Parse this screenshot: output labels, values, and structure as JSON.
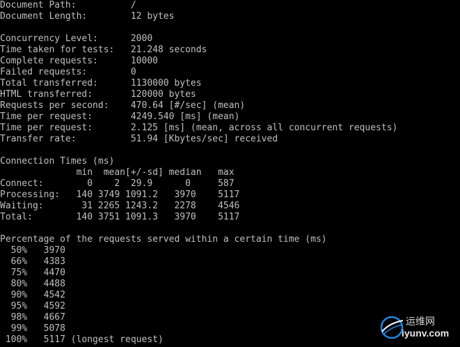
{
  "colors": {
    "background": "#000000",
    "text": "#c0c0c0",
    "watermark_blue": "#1e88e5"
  },
  "console": {
    "lines": [
      "Document Path:          /",
      "Document Length:        12 bytes",
      "",
      "Concurrency Level:      2000",
      "Time taken for tests:   21.248 seconds",
      "Complete requests:      10000",
      "Failed requests:        0",
      "Total transferred:      1130000 bytes",
      "HTML transferred:       120000 bytes",
      "Requests per second:    470.64 [#/sec] (mean)",
      "Time per request:       4249.540 [ms] (mean)",
      "Time per request:       2.125 [ms] (mean, across all concurrent requests)",
      "Transfer rate:          51.94 [Kbytes/sec] received",
      "",
      "Connection Times (ms)",
      "              min  mean[+/-sd] median   max",
      "Connect:        0    2  29.9      0     587",
      "Processing:   140 3749 1091.2   3970    5117",
      "Waiting:       31 2265 1243.2   2278    4546",
      "Total:        140 3751 1091.3   3970    5117",
      "",
      "Percentage of the requests served within a certain time (ms)",
      "  50%   3970",
      "  66%   4383",
      "  75%   4470",
      "  80%   4488",
      "  90%   4542",
      "  95%   4592",
      "  98%   4667",
      "  99%   5078",
      " 100%   5117 (longest request)"
    ]
  },
  "watermark": {
    "icon": "globe-swoosh-logo",
    "chinese": "运维网",
    "url": "iyunv.com"
  }
}
